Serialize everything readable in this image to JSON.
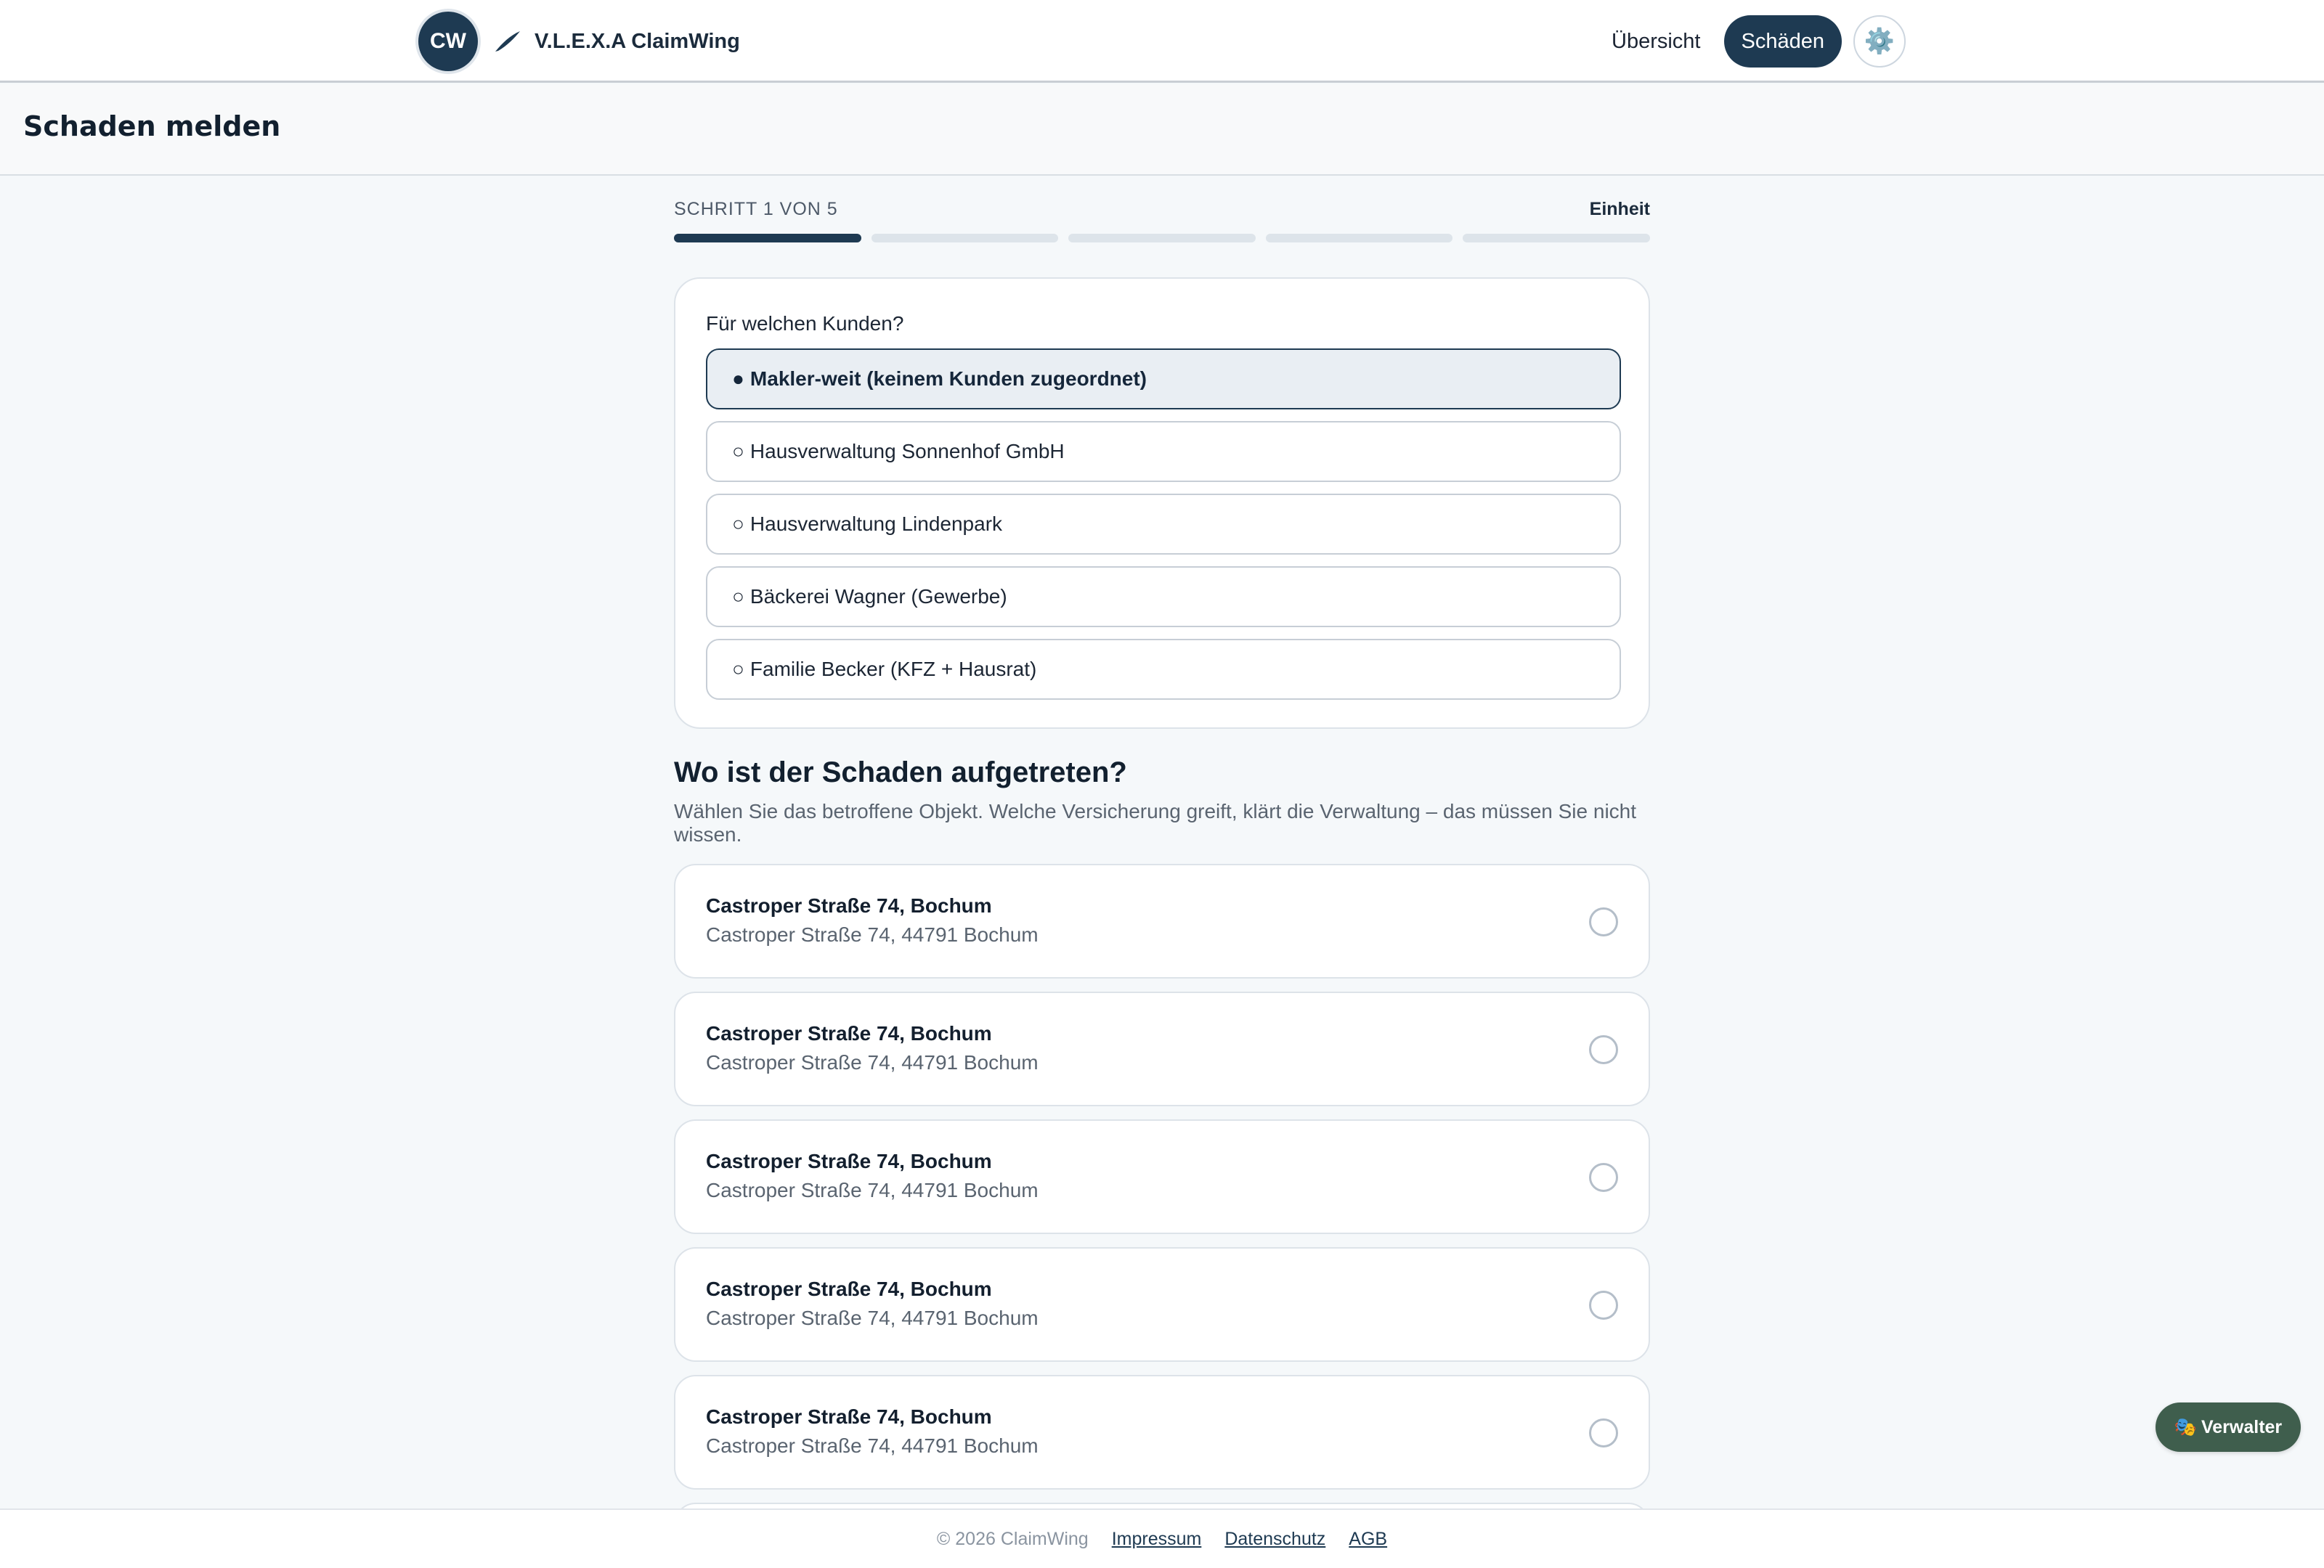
{
  "header": {
    "logo_initials": "CW",
    "brand_name": "V.L.E.X.A ClaimWing",
    "nav": {
      "overview": "Übersicht",
      "claims": "Schäden"
    },
    "settings_icon": "⚙️"
  },
  "page": {
    "title": "Schaden melden"
  },
  "stepper": {
    "label": "SCHRITT 1 VON 5",
    "step_name": "Einheit",
    "current": 1,
    "total": 5
  },
  "customer": {
    "question": "Für welchen Kunden?",
    "options": [
      {
        "mark": "●",
        "label": "Makler-weit (keinem Kunden zugeordnet)",
        "selected": true
      },
      {
        "mark": "○",
        "label": "Hausverwaltung Sonnenhof GmbH",
        "selected": false
      },
      {
        "mark": "○",
        "label": "Hausverwaltung Lindenpark",
        "selected": false
      },
      {
        "mark": "○",
        "label": "Bäckerei Wagner (Gewerbe)",
        "selected": false
      },
      {
        "mark": "○",
        "label": "Familie Becker (KFZ + Hausrat)",
        "selected": false
      }
    ]
  },
  "location": {
    "title": "Wo ist der Schaden aufgetreten?",
    "description": "Wählen Sie das betroffene Objekt. Welche Versicherung greift, klärt die Verwaltung – das müssen Sie nicht wissen.",
    "objects": [
      {
        "title": "Castroper Straße 74, Bochum",
        "address": "Castroper Straße 74, 44791 Bochum"
      },
      {
        "title": "Castroper Straße 74, Bochum",
        "address": "Castroper Straße 74, 44791 Bochum"
      },
      {
        "title": "Castroper Straße 74, Bochum",
        "address": "Castroper Straße 74, 44791 Bochum"
      },
      {
        "title": "Castroper Straße 74, Bochum",
        "address": "Castroper Straße 74, 44791 Bochum"
      },
      {
        "title": "Castroper Straße 74, Bochum",
        "address": "Castroper Straße 74, 44791 Bochum"
      }
    ]
  },
  "role_switch": {
    "icon": "🎭",
    "label": "Verwalter"
  },
  "footer": {
    "copyright": "© 2026 ClaimWing",
    "links": [
      "Impressum",
      "Datenschutz",
      "AGB"
    ]
  },
  "colors": {
    "brand": "#1e3a52",
    "role_pill": "#3f5e4d"
  }
}
